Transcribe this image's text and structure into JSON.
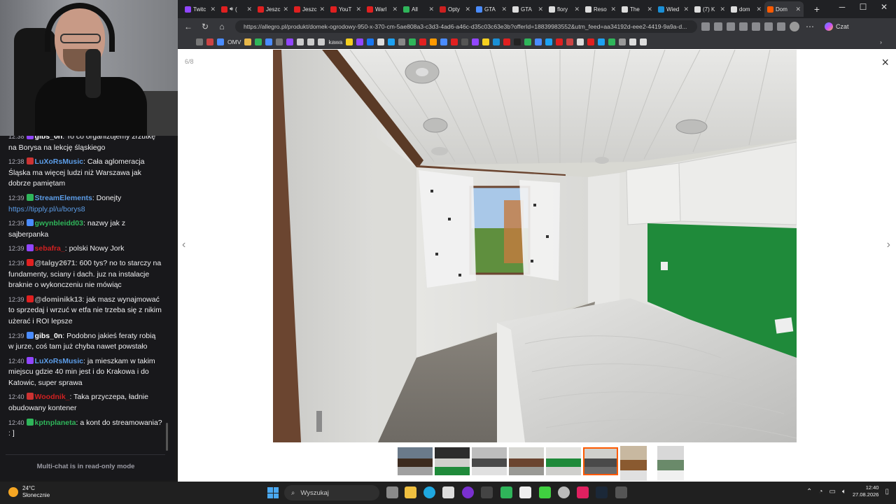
{
  "browser": {
    "tabs": [
      {
        "label": "Twitc",
        "color": "#9146ff"
      },
      {
        "label": "(",
        "color": "#e02020",
        "audio": true
      },
      {
        "label": "Jeszc",
        "color": "#e02020"
      },
      {
        "label": "Jeszc",
        "color": "#e02020"
      },
      {
        "label": "YouT",
        "color": "#e02020"
      },
      {
        "label": "Warl",
        "color": "#e02020"
      },
      {
        "label": "All",
        "color": "#2fb55a"
      },
      {
        "label": "Opty",
        "color": "#cc2020"
      },
      {
        "label": "GTA",
        "color": "#4a8cff"
      },
      {
        "label": "GTA",
        "color": "#dddddd"
      },
      {
        "label": "flory",
        "color": "#dddddd"
      },
      {
        "label": "Reso",
        "color": "#dddddd"
      },
      {
        "label": "The",
        "color": "#dddddd"
      },
      {
        "label": "Wied",
        "color": "#1a8fd6"
      },
      {
        "label": "(7) K",
        "color": "#dddddd"
      },
      {
        "label": "dom",
        "color": "#dddddd"
      },
      {
        "label": "Dom",
        "color": "#ff5a00",
        "active": true
      }
    ],
    "url": "https://allegro.pl/produkt/domek-ogrodowy-950-x-370-cm-5ae808a3-c3d3-4ad6-a46c-d35c03c63e3b?offerId=18839983552&utm_feed=aa34192d-eee2-4419-9a9a-d...",
    "czat_label": "Czat",
    "bookmarks": {
      "omv": "OMV",
      "kawa": "kawa"
    }
  },
  "gallery": {
    "counter": "6/8",
    "close_icon": "×",
    "prev_icon": "‹",
    "next_icon": "›",
    "thumbnail_count": 8,
    "selected_index": 5
  },
  "chat": {
    "messages": [
      {
        "time": "12:38",
        "user": "gibs_0n",
        "color": "#ffffff",
        "text": "To co organizujemy zrzutkę na Borysa na lekcję śląskiego"
      },
      {
        "time": "12:38",
        "user": "LuXoRsMusic",
        "color": "#5c9de8",
        "text": "Cała aglomeracja Śląska ma więcej ludzi niż Warszawa jak dobrze pamiętam"
      },
      {
        "time": "12:39",
        "user": "StreamElements",
        "color": "#5c9de8",
        "text": "Donejty",
        "link": "https://tipply.pl/u/borys8"
      },
      {
        "time": "12:39",
        "user": "gwynbleidd03",
        "color": "#2fb55a",
        "text": "nazwy jak z sajberpanka"
      },
      {
        "time": "12:39",
        "user": "sebafra_",
        "color": "#d02020",
        "text": "polski Nowy Jork"
      },
      {
        "time": "12:39",
        "user": "@talgy2671",
        "color": "#b8b8b8",
        "text": "600 tys? no to starczy na fundamenty, sciany i dach. juz na instalacje braknie o wykonczeniu nie mówiąc"
      },
      {
        "time": "12:39",
        "user": "@dominikk13",
        "color": "#b8b8b8",
        "text": "jak masz wynajmować to sprzedaj i wrzuć w etfa nie trzeba się z nikim użerać i ROI lepsze"
      },
      {
        "time": "12:39",
        "user": "gibs_0n",
        "color": "#ffffff",
        "text": "Podobno jakieś feraty robią w jurze, coś tam już chyba nawet powstało"
      },
      {
        "time": "12:40",
        "user": "LuXoRsMusic",
        "color": "#5c9de8",
        "text": "ja mieszkam w takim miejscu gdzie 40 min jest i do Krakowa i do Katowic, super sprawa"
      },
      {
        "time": "12:40",
        "user": "Woodnik_",
        "color": "#d02020",
        "text": "Taka przyczepa, ładnie obudowany kontener"
      },
      {
        "time": "12:40",
        "user": "kptnplaneta",
        "color": "#2fb55a",
        "text": "a kont do streamowania? : ]"
      }
    ],
    "readonly": "Multi-chat is in read-only mode"
  },
  "taskbar": {
    "weather_temp": "24°C",
    "weather_desc": "Słonecznie",
    "search_placeholder": "Wyszukaj",
    "time": "12:40",
    "date": "27.08.2026"
  }
}
